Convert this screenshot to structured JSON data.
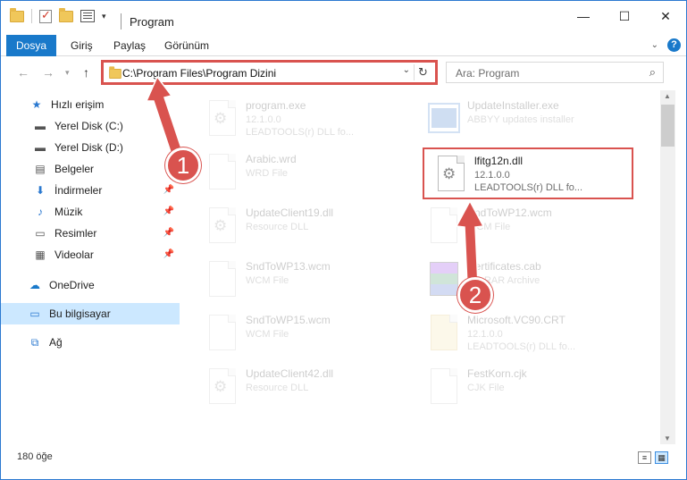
{
  "window": {
    "title": "Program",
    "controls": {
      "minimize": "—",
      "maximize": "☐",
      "close": "✕"
    }
  },
  "ribbon": {
    "tabs": [
      "Dosya",
      "Giriş",
      "Paylaş",
      "Görünüm"
    ]
  },
  "address": {
    "path": "C:\\Program Files\\Program Dizini",
    "search_placeholder": "Ara: Program"
  },
  "sidebar": {
    "items": [
      {
        "label": "Hızlı erişim",
        "icon": "star-icon"
      },
      {
        "label": "Yerel Disk (C:)",
        "icon": "drive-icon"
      },
      {
        "label": "Yerel Disk (D:)",
        "icon": "drive-icon"
      },
      {
        "label": "Belgeler",
        "icon": "documents-icon"
      },
      {
        "label": "İndirmeler",
        "icon": "download-icon"
      },
      {
        "label": "Müzik",
        "icon": "music-icon"
      },
      {
        "label": "Resimler",
        "icon": "pictures-icon"
      },
      {
        "label": "Videolar",
        "icon": "video-icon"
      },
      {
        "label": "OneDrive",
        "icon": "cloud-icon"
      },
      {
        "label": "Bu bilgisayar",
        "icon": "computer-icon"
      },
      {
        "label": "Ağ",
        "icon": "network-icon"
      }
    ]
  },
  "files": [
    {
      "name": "program.exe",
      "line1": "12.1.0.0",
      "line2": "LEADTOOLS(r) DLL fo...",
      "icon": "exe-icon",
      "highlighted": false
    },
    {
      "name": "UpdateInstaller.exe",
      "line1": "ABBYY updates installer",
      "line2": "",
      "icon": "installer-icon",
      "highlighted": false
    },
    {
      "name": "Arabic.wrd",
      "line1": "WRD File",
      "line2": "",
      "icon": "file-icon",
      "highlighted": false
    },
    {
      "name": "lfitg12n.dll",
      "line1": "12.1.0.0",
      "line2": "LEADTOOLS(r) DLL fo...",
      "icon": "dll-icon",
      "highlighted": true
    },
    {
      "name": "UpdateClient19.dll",
      "line1": "Resource DLL",
      "line2": "",
      "icon": "dll-icon",
      "highlighted": false
    },
    {
      "name": "SndToWP12.wcm",
      "line1": "WCM File",
      "line2": "",
      "icon": "file-icon",
      "highlighted": false
    },
    {
      "name": "SndToWP13.wcm",
      "line1": "WCM File",
      "line2": "",
      "icon": "file-icon",
      "highlighted": false
    },
    {
      "name": "Certificates.cab",
      "line1": "WinRAR Archive",
      "line2": "",
      "icon": "archive-icon",
      "highlighted": false
    },
    {
      "name": "SndToWP15.wcm",
      "line1": "WCM File",
      "line2": "",
      "icon": "file-icon",
      "highlighted": false
    },
    {
      "name": "Microsoft.VC90.CRT",
      "line1": "12.1.0.0",
      "line2": "LEADTOOLS(r) DLL fo...",
      "icon": "folder-icon",
      "highlighted": false
    },
    {
      "name": "UpdateClient42.dll",
      "line1": "Resource DLL",
      "line2": "",
      "icon": "dll-icon",
      "highlighted": false
    },
    {
      "name": "FestKorn.cjk",
      "line1": "CJK File",
      "line2": "",
      "icon": "file-icon",
      "highlighted": false
    }
  ],
  "status": {
    "count": "180 öğe"
  },
  "annotations": {
    "badge1": "1",
    "badge2": "2"
  },
  "colors": {
    "accent": "#1979ca",
    "annotation": "#d9534f",
    "selected": "#cce8ff"
  }
}
